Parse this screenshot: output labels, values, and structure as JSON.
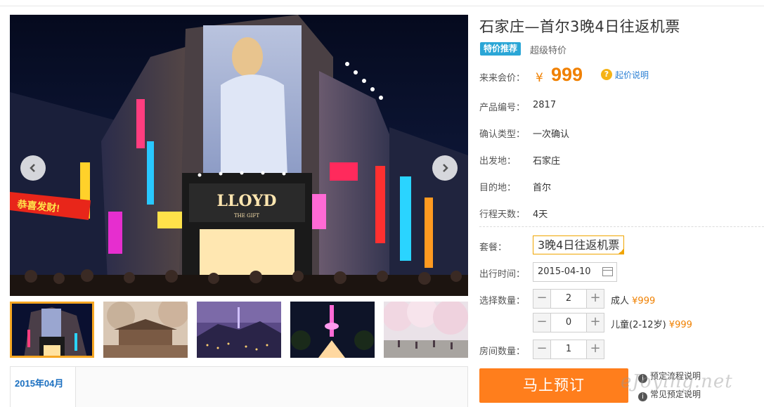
{
  "product": {
    "title": "石家庄—首尔3晚4日往返机票",
    "badge": "特价推荐",
    "badge_note": "超级特价",
    "price_label": "来来会价：",
    "currency": "¥",
    "price": "999",
    "price_help": "起价说明",
    "code_label": "产品编号：",
    "code": "2817",
    "confirm_label": "确认类型：",
    "confirm": "一次确认",
    "depart_label": "出发地：",
    "depart": "石家庄",
    "dest_label": "目的地：",
    "dest": "首尔",
    "days_label": "行程天数：",
    "days": "4天"
  },
  "booking": {
    "package_label": "套餐：",
    "package": "3晚4日往返机票",
    "date_label": "出行时间：",
    "date": "2015-04-10",
    "qty_label": "选择数量：",
    "adults": "2",
    "adult_label": "成人",
    "adult_price": "¥999",
    "children": "0",
    "child_label": "儿童(2-12岁)",
    "child_price": "¥999",
    "rooms_label": "房间数量：",
    "rooms": "1",
    "book_button": "马上预订",
    "link_process": "预定流程说明",
    "link_faq": "常见预定说明"
  },
  "gallery": {
    "calendar_month": "2015年04月",
    "sign_lloyd": "LLOYD",
    "sign_gift": "THE GIFT",
    "sign_banner": "恭喜发财!"
  },
  "watermark": "eJoying.net",
  "colors": {
    "accent": "#f08000",
    "button": "#ff7e1c",
    "badge": "#2aa6d6",
    "link": "#2a7fd4",
    "selected": "#f0a500"
  },
  "icons": {
    "prev": "chevron-left-icon",
    "next": "chevron-right-icon",
    "help": "question-icon",
    "calendar": "calendar-icon"
  }
}
